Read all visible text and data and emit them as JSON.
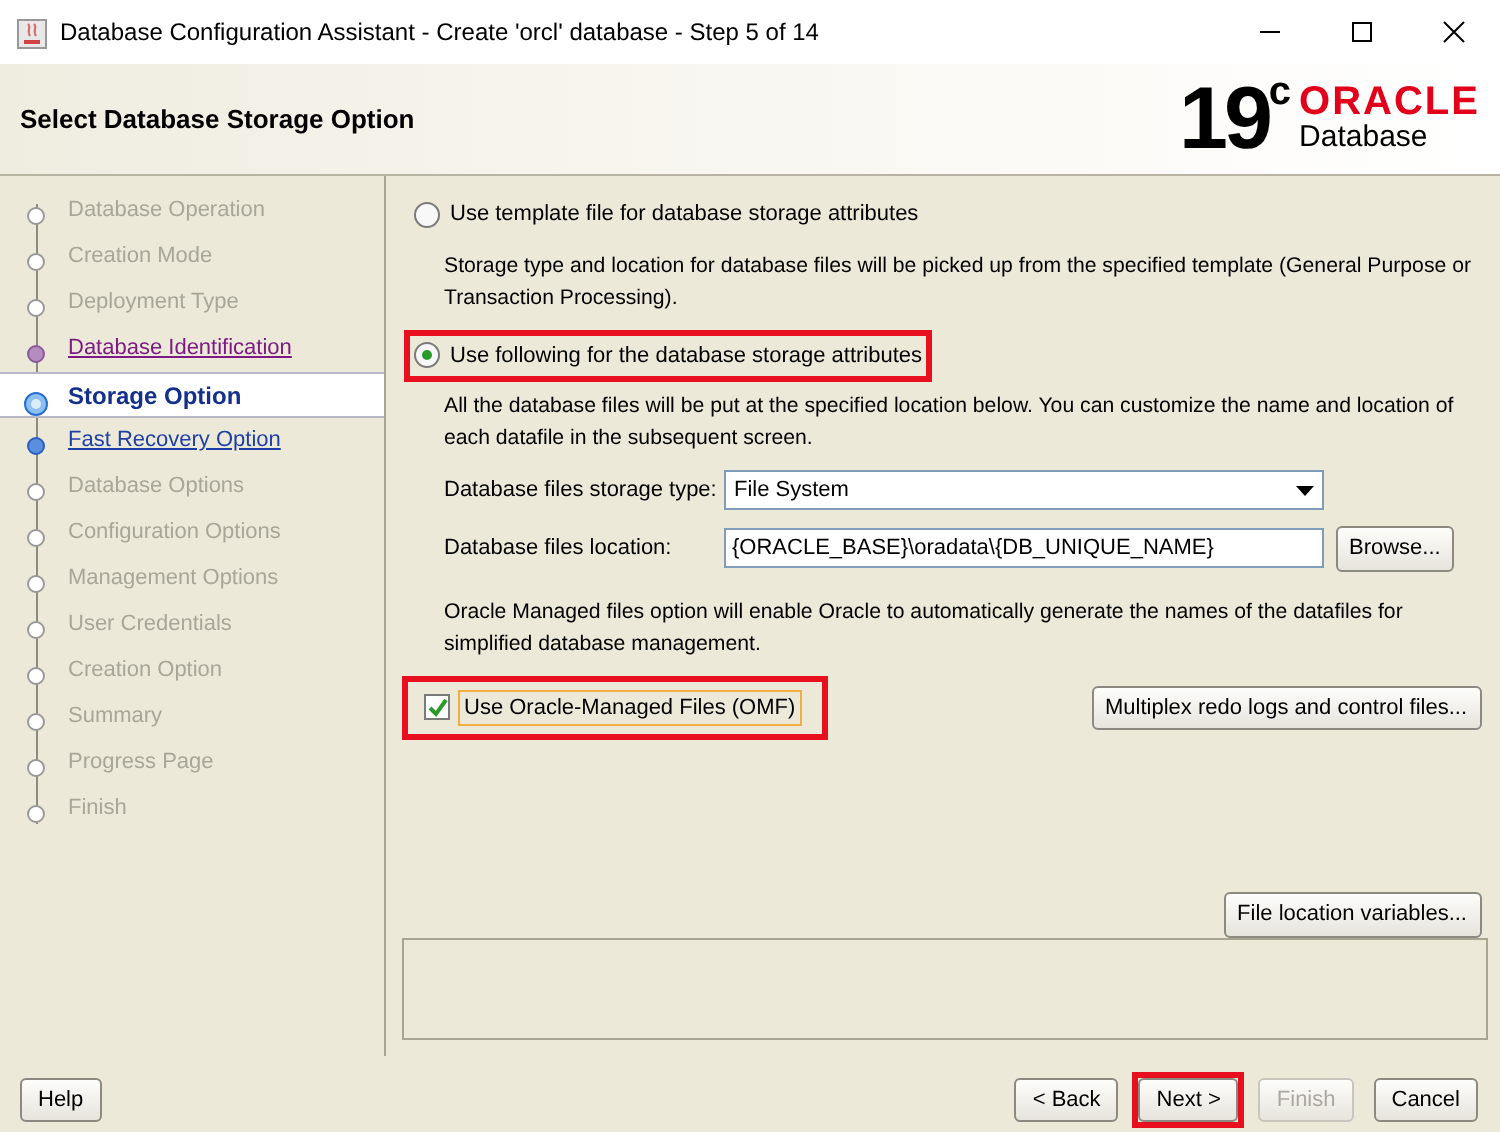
{
  "window": {
    "title": "Database Configuration Assistant - Create 'orcl' database - Step 5 of 14"
  },
  "header": {
    "title": "Select Database Storage Option",
    "logo": {
      "version": "19",
      "version_sup": "c",
      "brand": "ORACLE",
      "product": "Database"
    }
  },
  "steps": [
    {
      "label": "Database Operation",
      "kind": "pending",
      "selected": false
    },
    {
      "label": "Creation Mode",
      "kind": "pending",
      "selected": false
    },
    {
      "label": "Deployment Type",
      "kind": "pending",
      "selected": false
    },
    {
      "label": "Database Identification",
      "kind": "visited",
      "selected": false
    },
    {
      "label": "Storage Option",
      "kind": "link",
      "selected": true
    },
    {
      "label": "Fast Recovery Option",
      "kind": "link",
      "selected": false
    },
    {
      "label": "Database Options",
      "kind": "pending",
      "selected": false
    },
    {
      "label": "Configuration Options",
      "kind": "pending",
      "selected": false
    },
    {
      "label": "Management Options",
      "kind": "pending",
      "selected": false
    },
    {
      "label": "User Credentials",
      "kind": "pending",
      "selected": false
    },
    {
      "label": "Creation Option",
      "kind": "pending",
      "selected": false
    },
    {
      "label": "Summary",
      "kind": "pending",
      "selected": false
    },
    {
      "label": "Progress Page",
      "kind": "pending",
      "selected": false
    },
    {
      "label": "Finish",
      "kind": "pending",
      "selected": false
    }
  ],
  "storage_options": [
    {
      "label": "Use template file for database storage attributes",
      "selected": false,
      "highlighted": false,
      "description": "Storage type and location for database files will be picked up from the specified template (General Purpose or Transaction Processing)."
    },
    {
      "label": "Use following for the database storage attributes",
      "selected": true,
      "highlighted": true,
      "description": "All the database files will be put at the specified location below. You can customize the name and location of each datafile in the subsequent screen."
    }
  ],
  "storage_type": {
    "label": "Database files storage type:",
    "value": "File System"
  },
  "files_location": {
    "label": "Database files location:",
    "value": "{ORACLE_BASE}\\oradata\\{DB_UNIQUE_NAME}",
    "button": "Browse..."
  },
  "omf": {
    "description": "Oracle Managed files option will enable Oracle to automatically generate the names of the datafiles for simplified database management.",
    "label": "Use Oracle-Managed Files (OMF)",
    "checked": true,
    "highlighted": true
  },
  "multiplex_button": "Multiplex redo logs and control files...",
  "file_location_variables_button": "File location variables...",
  "footer": {
    "help": "Help",
    "buttons": [
      {
        "label": "< Back",
        "disabled": false,
        "highlighted": false
      },
      {
        "label": "Next >",
        "disabled": false,
        "highlighted": true
      },
      {
        "label": "Finish",
        "disabled": true,
        "highlighted": false
      },
      {
        "label": "Cancel",
        "disabled": false,
        "highlighted": false
      }
    ]
  }
}
